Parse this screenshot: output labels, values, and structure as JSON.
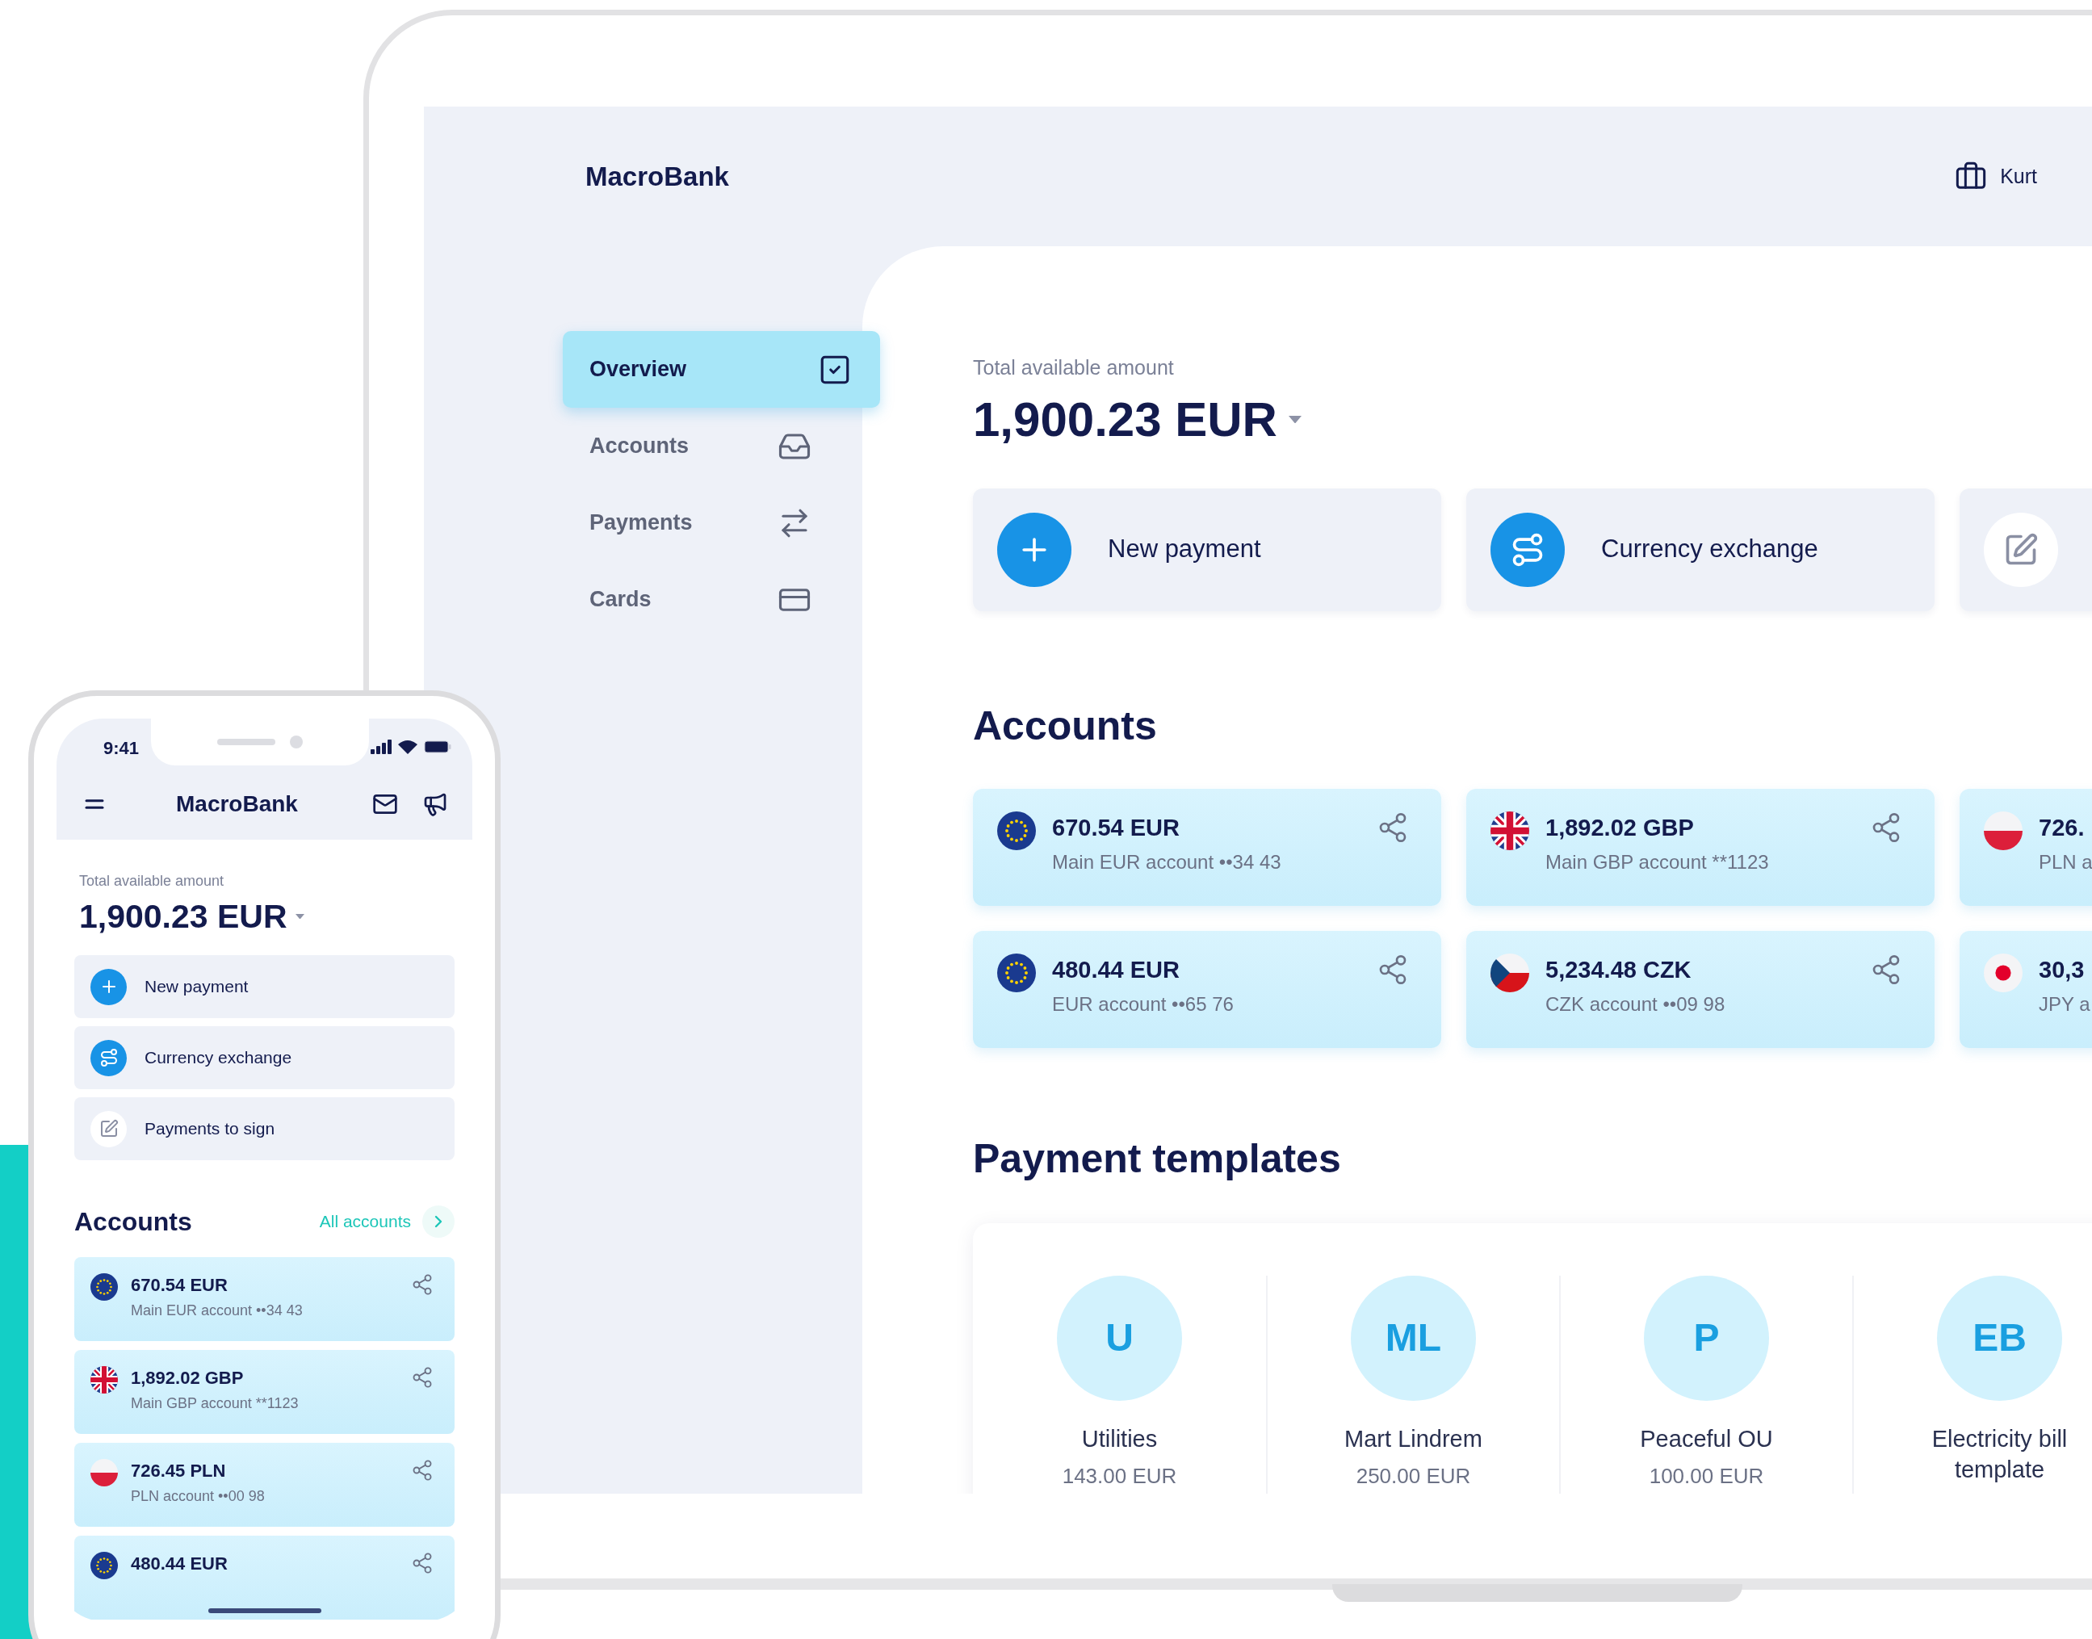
{
  "laptop": {
    "brand": "MacroBank",
    "user": "Kurt",
    "nav": [
      {
        "label": "Overview",
        "selected": true
      },
      {
        "label": "Accounts",
        "selected": false
      },
      {
        "label": "Payments",
        "selected": false
      },
      {
        "label": "Cards",
        "selected": false
      }
    ],
    "total_label": "Total available amount",
    "total_amount": "1,900.23 EUR",
    "actions": [
      {
        "kind": "plus",
        "label": "New payment"
      },
      {
        "kind": "exchange",
        "label": "Currency exchange"
      },
      {
        "kind": "sign"
      }
    ],
    "accounts_title": "Accounts",
    "accounts": [
      {
        "amount": "670.54 EUR",
        "name": "Main EUR account ••34 43",
        "kind": "eu"
      },
      {
        "amount": "1,892.02 GBP",
        "name": "Main GBP account **1123",
        "kind": "gb"
      },
      {
        "amount": "726.",
        "name": "PLN a",
        "kind": "pl"
      },
      {
        "amount": "480.44 EUR",
        "name": "EUR account ••65 76",
        "kind": "eu"
      },
      {
        "amount": "5,234.48 CZK",
        "name": "CZK account ••09 98",
        "kind": "cz"
      },
      {
        "amount": "30,3",
        "name": "JPY a",
        "kind": "jp"
      }
    ],
    "templates_title": "Payment templates",
    "templates": [
      {
        "initials": "U",
        "name": "Utilities",
        "amount": "143.00 EUR"
      },
      {
        "initials": "ML",
        "name": "Mart Lindrem",
        "amount": "250.00 EUR"
      },
      {
        "initials": "P",
        "name": "Peaceful OU",
        "amount": "100.00 EUR"
      },
      {
        "initials": "EB",
        "name": "Electricity bill template"
      }
    ]
  },
  "phone": {
    "time": "9:41",
    "brand": "MacroBank",
    "total_label": "Total available amount",
    "total_amount": "1,900.23 EUR",
    "actions": [
      {
        "kind": "plus",
        "label": "New payment"
      },
      {
        "kind": "exchange",
        "label": "Currency exchange"
      },
      {
        "kind": "sign",
        "label": "Payments to sign"
      }
    ],
    "accounts_title": "Accounts",
    "all_accounts": "All accounts",
    "accounts": [
      {
        "amount": "670.54 EUR",
        "name": "Main EUR account ••34 43",
        "kind": "eu"
      },
      {
        "amount": "1,892.02 GBP",
        "name": "Main GBP account **1123",
        "kind": "gb"
      },
      {
        "amount": "726.45 PLN",
        "name": "PLN account ••00 98",
        "kind": "pl"
      },
      {
        "amount": "480.44 EUR",
        "kind": "eu"
      }
    ]
  }
}
